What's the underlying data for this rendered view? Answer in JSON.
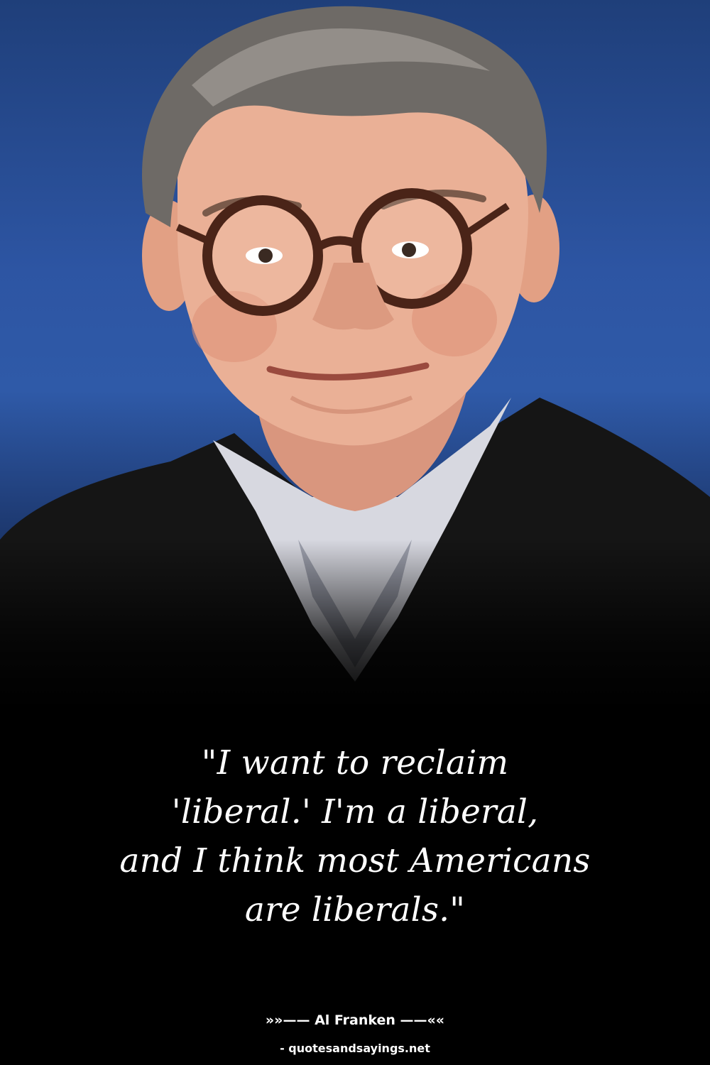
{
  "quote": {
    "text": "\"I want to reclaim\n'liberal.' I'm a liberal,\nand I think most Americans\nare liberals.\""
  },
  "attribution": {
    "author_line": "»»—— Al Franken ——««",
    "source_line": "- quotesandsayings.net"
  },
  "colors": {
    "background_top": "#2d55a3",
    "background_bottom": "#000000",
    "text": "#ffffff"
  }
}
